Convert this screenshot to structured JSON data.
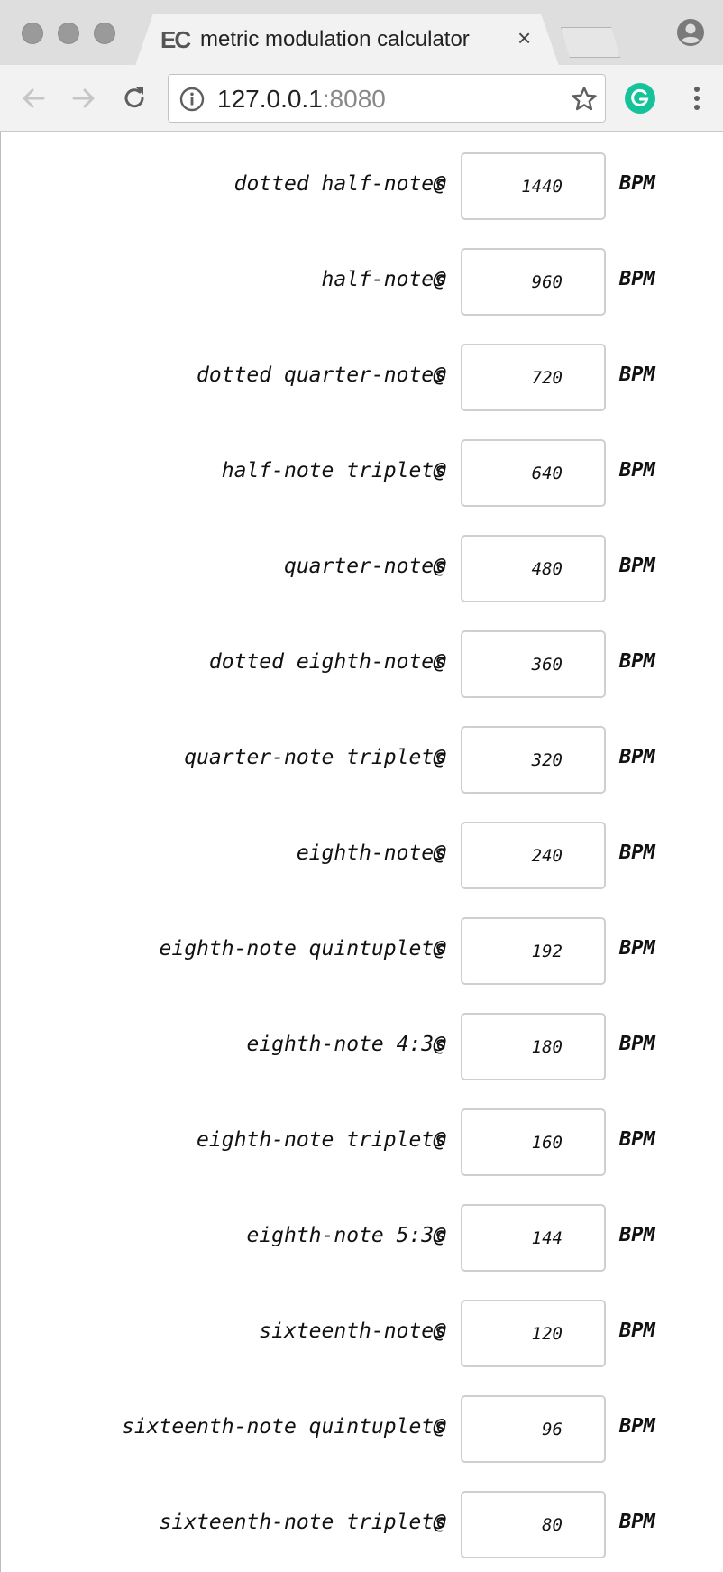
{
  "browser": {
    "tab": {
      "favicon_text": "EC",
      "title": "metric modulation calculator",
      "close_glyph": "×"
    },
    "address_bar": {
      "host": "127.0.0.1",
      "port": ":8080"
    },
    "icons": {
      "back": "arrow-left-icon",
      "forward": "arrow-right-icon",
      "reload": "reload-icon",
      "info": "info-icon",
      "bookmark": "star-icon",
      "grammarly": "grammarly-icon",
      "menu": "kebab-menu-icon",
      "profile": "profile-icon"
    },
    "accent_green": "#15c39a"
  },
  "calculator": {
    "at_symbol": "@",
    "unit": "BPM",
    "rows": [
      {
        "label": "dotted half-notes",
        "value": "1440"
      },
      {
        "label": "half-notes",
        "value": "960"
      },
      {
        "label": "dotted quarter-notes",
        "value": "720"
      },
      {
        "label": "half-note triplets",
        "value": "640"
      },
      {
        "label": "quarter-notes",
        "value": "480"
      },
      {
        "label": "dotted eighth-notes",
        "value": "360"
      },
      {
        "label": "quarter-note triplets",
        "value": "320"
      },
      {
        "label": "eighth-notes",
        "value": "240"
      },
      {
        "label": "eighth-note quintuplets",
        "value": "192"
      },
      {
        "label": "eighth-note 4:3s",
        "value": "180"
      },
      {
        "label": "eighth-note triplets",
        "value": "160"
      },
      {
        "label": "eighth-note 5:3s",
        "value": "144"
      },
      {
        "label": "sixteenth-notes",
        "value": "120"
      },
      {
        "label": "sixteenth-note quintuplets",
        "value": "96"
      },
      {
        "label": "sixteenth-note triplets",
        "value": "80"
      }
    ]
  }
}
